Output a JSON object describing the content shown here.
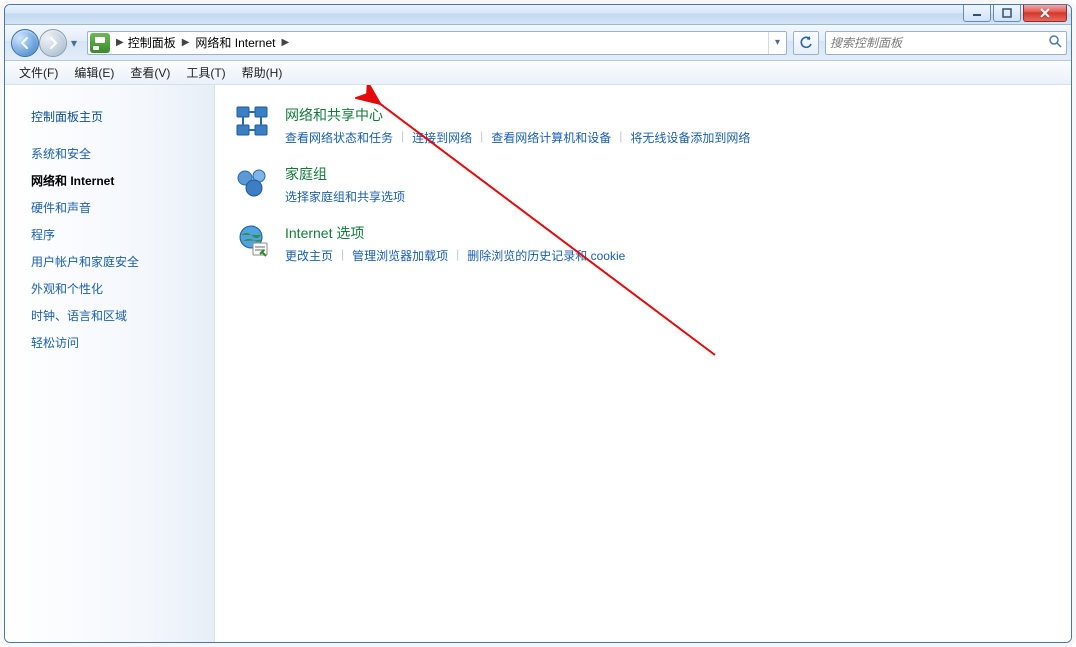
{
  "window": {
    "controls": {
      "minimize": "min",
      "maximize": "max",
      "close": "close"
    }
  },
  "nav": {
    "breadcrumb": [
      "控制面板",
      "网络和 Internet"
    ],
    "search_placeholder": "搜索控制面板"
  },
  "menu": {
    "items": [
      "文件(F)",
      "编辑(E)",
      "查看(V)",
      "工具(T)",
      "帮助(H)"
    ]
  },
  "sidebar": {
    "home": "控制面板主页",
    "items": [
      "系统和安全",
      "网络和 Internet",
      "硬件和声音",
      "程序",
      "用户帐户和家庭安全",
      "外观和个性化",
      "时钟、语言和区域",
      "轻松访问"
    ],
    "active_index": 1
  },
  "categories": [
    {
      "id": "network-sharing",
      "title": "网络和共享中心",
      "links": [
        "查看网络状态和任务",
        "连接到网络",
        "查看网络计算机和设备",
        "将无线设备添加到网络"
      ]
    },
    {
      "id": "homegroup",
      "title": "家庭组",
      "links": [
        "选择家庭组和共享选项"
      ]
    },
    {
      "id": "internet-options",
      "title": "Internet 选项",
      "links": [
        "更改主页",
        "管理浏览器加载项",
        "删除浏览的历史记录和 cookie"
      ]
    }
  ]
}
